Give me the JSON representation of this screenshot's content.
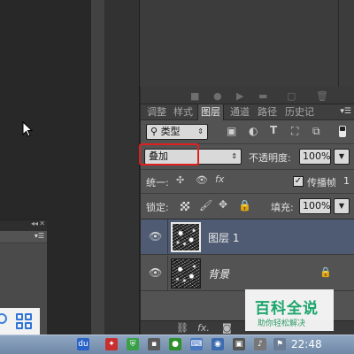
{
  "panel_icons": [
    "stop-icon",
    "record-icon",
    "play-icon",
    "new-set-icon",
    "new-action-icon",
    "delete-icon"
  ],
  "tabs": [
    {
      "label": "调整",
      "active": false
    },
    {
      "label": "样式",
      "active": false
    },
    {
      "label": "图层",
      "active": true
    },
    {
      "label": "通道",
      "active": false
    },
    {
      "label": "路径",
      "active": false
    },
    {
      "label": "历史记",
      "active": false
    }
  ],
  "filter": {
    "kind_label": "类型",
    "arrow": "⇕"
  },
  "blend": {
    "mode": "叠加",
    "arrow": "⇕"
  },
  "opacity": {
    "label": "不透明度:",
    "value": "100%"
  },
  "unify": {
    "label": "统一:",
    "propagate_label": "传播帧",
    "propagate_num": "1",
    "propagate_checked": "✓"
  },
  "lock": {
    "label": "锁定:"
  },
  "fill": {
    "label": "填充:",
    "value": "100%"
  },
  "layers": [
    {
      "name": "图层 1",
      "selected": true,
      "italic": false
    },
    {
      "name": "背景",
      "selected": false,
      "italic": true
    }
  ],
  "bottom_fx": "fx.",
  "watermark": {
    "title": "百科全说",
    "subtitle": "助你轻松解决"
  },
  "taskbar": {
    "time": "22:48"
  }
}
